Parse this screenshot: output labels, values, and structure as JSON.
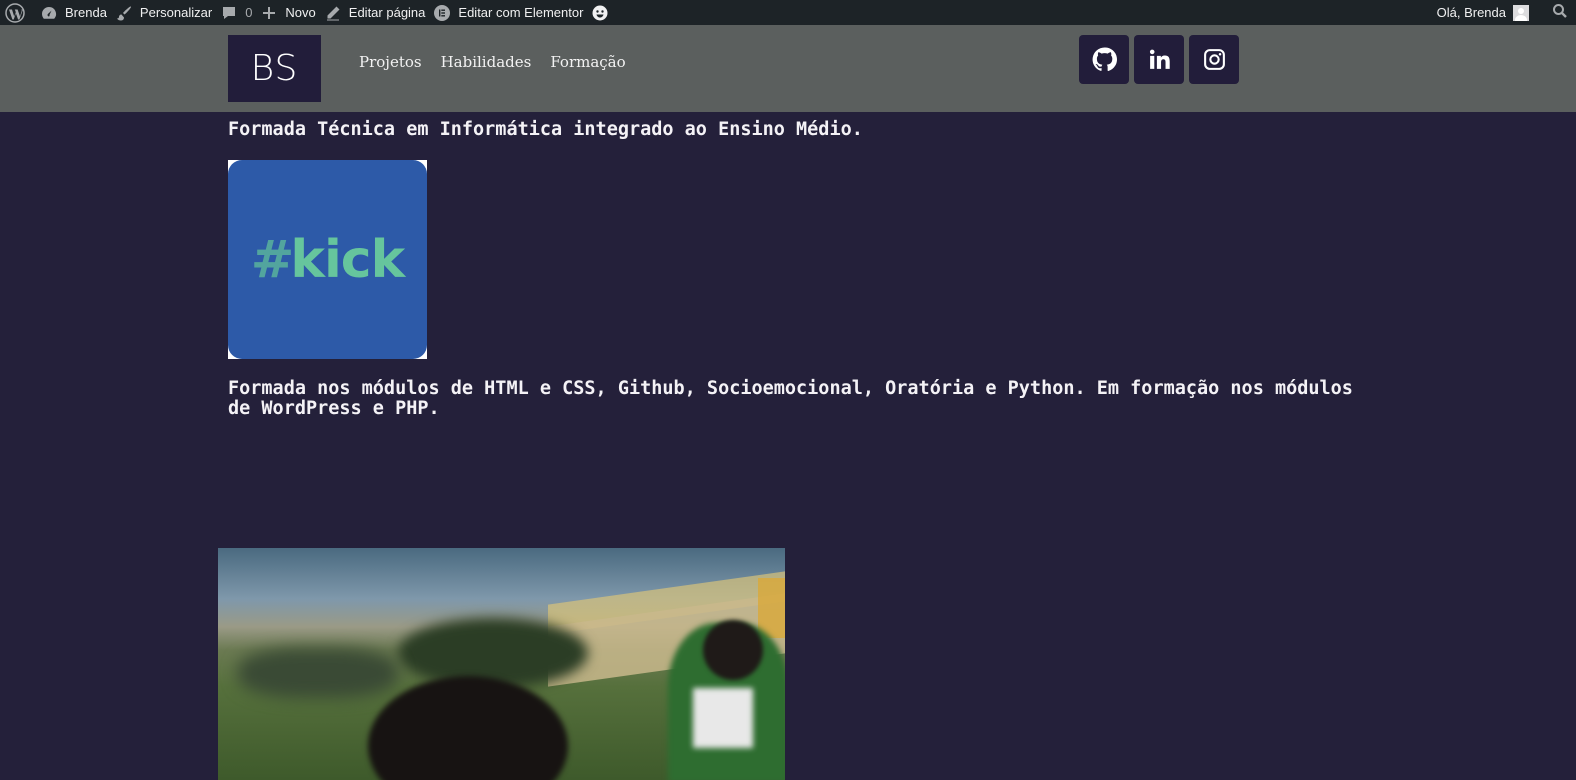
{
  "admin_bar": {
    "site_name": "Brenda",
    "customize": "Personalizar",
    "comments_count": "0",
    "new": "Novo",
    "edit_page": "Editar página",
    "edit_elementor": "Editar com Elementor",
    "greeting": "Olá, Brenda"
  },
  "header": {
    "logo_text": "BS",
    "nav": [
      "Projetos",
      "Habilidades",
      "Formação"
    ],
    "socials": [
      "github-icon",
      "linkedin-icon",
      "instagram-icon"
    ]
  },
  "content": {
    "paragraph1": "Formada Técnica em Informática integrado ao Ensino Médio.",
    "kick_logo": {
      "hash": "#",
      "word": "kick"
    },
    "paragraph2": "Formada nos módulos de HTML e CSS, Github, Socioemocional, Oratória e Python. Em formação nos módulos de WordPress e PHP."
  },
  "colors": {
    "admin_bar_bg": "#1d2327",
    "header_bg": "#5b5f5e",
    "page_bg": "#24203a",
    "kick_bg": "#2d5aa8",
    "kick_green": "#66c59d"
  }
}
